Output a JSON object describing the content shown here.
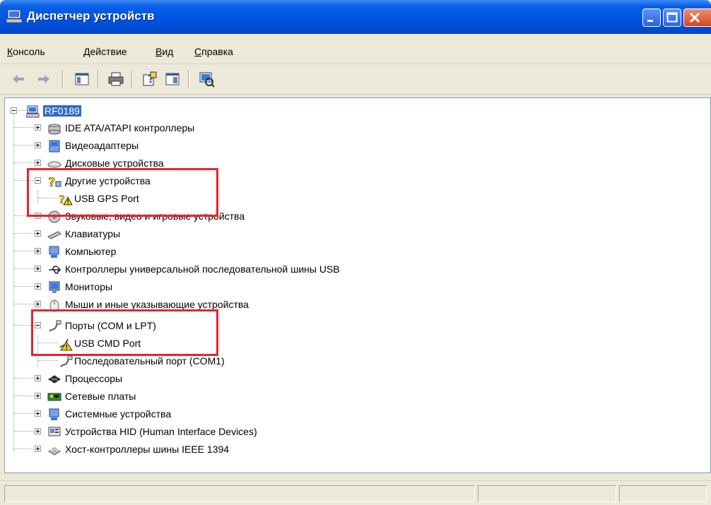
{
  "window": {
    "title": "Диспетчер устройств"
  },
  "menu": [
    {
      "label": "Консоль",
      "accel": "К",
      "rest": "онсоль"
    },
    {
      "label": "Действие",
      "accel": "Д",
      "rest": "ействие"
    },
    {
      "label": "Вид",
      "accel": "В",
      "rest": "ид"
    },
    {
      "label": "Справка",
      "accel": "С",
      "rest": "правка"
    }
  ],
  "toolbar": {
    "buttons": [
      "back-icon",
      "forward-icon",
      "show-hide-tree-icon",
      "print-icon",
      "help-icon",
      "properties-icon",
      "scan-hardware-icon"
    ]
  },
  "tree": {
    "root": "RF0189",
    "items": [
      {
        "label": "IDE ATA/ATAPI контроллеры",
        "icon": "ide-controller-icon",
        "expanded": false
      },
      {
        "label": "Видеоадаптеры",
        "icon": "display-adapter-icon",
        "expanded": false
      },
      {
        "label": "Дисковые устройства",
        "icon": "disk-drive-icon",
        "expanded": false
      },
      {
        "label": "Другие устройства",
        "icon": "unknown-device-icon",
        "expanded": true
      },
      {
        "label": "USB GPS Port",
        "icon": "warning-device-icon",
        "child": true
      },
      {
        "label": "Звуковые, видео и игровые устройства",
        "icon": "sound-icon",
        "expanded": false
      },
      {
        "label": "Клавиатуры",
        "icon": "keyboard-icon",
        "expanded": false
      },
      {
        "label": "Компьютер",
        "icon": "computer-icon",
        "expanded": false
      },
      {
        "label": "Контроллеры универсальной последовательной шины USB",
        "icon": "usb-icon",
        "expanded": false
      },
      {
        "label": "Мониторы",
        "icon": "monitor-icon",
        "expanded": false
      },
      {
        "label": "Мыши и иные указывающие устройства",
        "icon": "mouse-icon",
        "expanded": false
      },
      {
        "label": "Порты (COM и LPT)",
        "icon": "port-icon",
        "expanded": true
      },
      {
        "label": "USB CMD Port",
        "icon": "warning-port-icon",
        "child": true
      },
      {
        "label": "Последовательный порт (COM1)",
        "icon": "port-icon",
        "child": true
      },
      {
        "label": "Процессоры",
        "icon": "processor-icon",
        "expanded": false
      },
      {
        "label": "Сетевые платы",
        "icon": "network-card-icon",
        "expanded": false
      },
      {
        "label": "Системные устройства",
        "icon": "system-device-icon",
        "expanded": false
      },
      {
        "label": "Устройства HID (Human Interface Devices)",
        "icon": "hid-icon",
        "expanded": false
      },
      {
        "label": "Хост-контроллеры шины IEEE 1394",
        "icon": "ieee1394-icon",
        "expanded": false
      }
    ]
  },
  "colors": {
    "titlebar": "#0054e3",
    "selection": "#316ac5",
    "highlight_box": "#e8232b"
  }
}
